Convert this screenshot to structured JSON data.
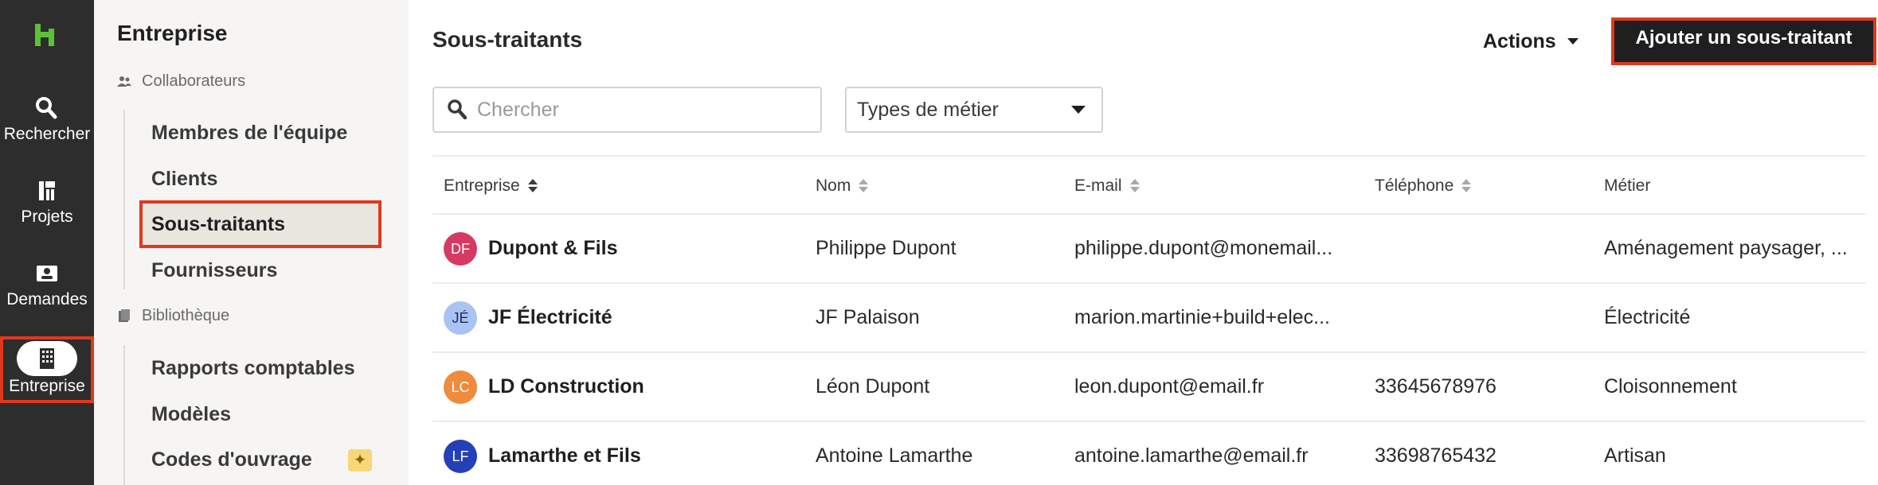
{
  "rail": {
    "items": [
      {
        "label": "Rechercher",
        "icon": "search-icon"
      },
      {
        "label": "Projets",
        "icon": "projects-icon"
      },
      {
        "label": "Demandes",
        "icon": "requests-icon"
      },
      {
        "label": "Entreprise",
        "icon": "building-icon",
        "active": true
      }
    ]
  },
  "sidebar": {
    "title": "Entreprise",
    "groups": [
      {
        "label": "Collaborateurs",
        "icon": "people-icon",
        "items": [
          "Membres de l'équipe",
          "Clients",
          "Sous-traitants",
          "Fournisseurs"
        ]
      },
      {
        "label": "Bibliothèque",
        "icon": "library-icon",
        "items": [
          "Rapports comptables",
          "Modèles",
          "Codes d'ouvrage"
        ]
      }
    ],
    "selected": "Sous-traitants",
    "sparkle_glyph": "✦"
  },
  "main": {
    "title": "Sous-traitants",
    "actions_label": "Actions",
    "add_label": "Ajouter un sous-traitant",
    "search_placeholder": "Chercher",
    "filter_label": "Types de métier"
  },
  "table": {
    "columns": [
      "Entreprise",
      "Nom",
      "E-mail",
      "Téléphone",
      "Métier"
    ],
    "rows": [
      {
        "initials": "DF",
        "color": "#d63a63",
        "company": "Dupont & Fils",
        "name": "Philippe Dupont",
        "email": "philippe.dupont@monemail...",
        "phone": "",
        "trade": "Aménagement paysager, ..."
      },
      {
        "initials": "JÉ",
        "color": "#a9c3f2",
        "company": "JF Électricité",
        "name": "JF Palaison",
        "email": "marion.martinie+build+elec...",
        "phone": "",
        "trade": "Électricité"
      },
      {
        "initials": "LC",
        "color": "#f08a3c",
        "company": "LD Construction",
        "name": "Léon Dupont",
        "email": "leon.dupont@email.fr",
        "phone": "33645678976",
        "trade": "Cloisonnement"
      },
      {
        "initials": "LF",
        "color": "#2440b8",
        "company": "Lamarthe et Fils",
        "name": "Antoine Lamarthe",
        "email": "antoine.lamarthe@email.fr",
        "phone": "33698765432",
        "trade": "Artisan"
      }
    ]
  },
  "colors": {
    "accent_highlight": "#e0381f",
    "rail_bg": "#2d2d2d",
    "brand_green": "#5bc236"
  }
}
